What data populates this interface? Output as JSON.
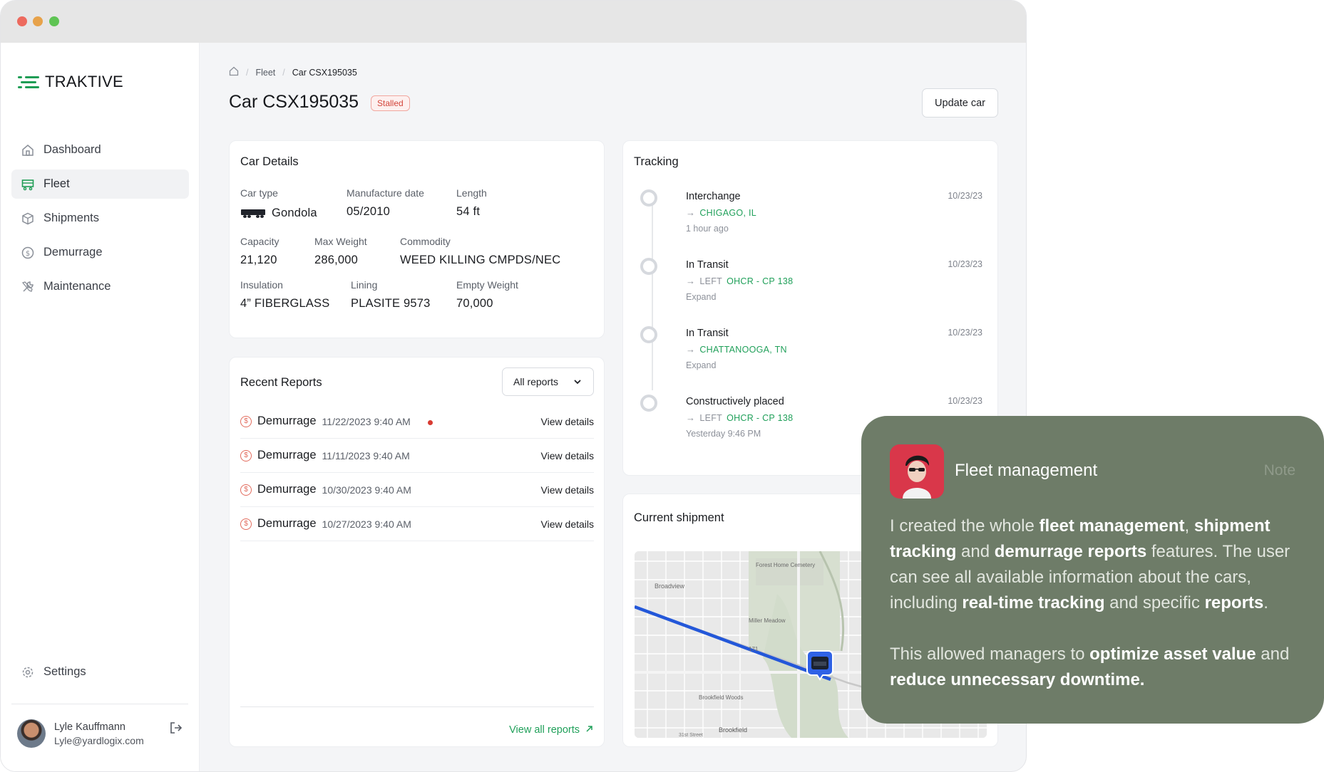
{
  "app": {
    "logo_text": "TRAKTIVE",
    "accent": "#1f9d55"
  },
  "sidebar": {
    "items": [
      {
        "label": "Dashboard",
        "icon": "home-icon",
        "active": false
      },
      {
        "label": "Fleet",
        "icon": "railcar-icon",
        "active": true
      },
      {
        "label": "Shipments",
        "icon": "box-icon",
        "active": false
      },
      {
        "label": "Demurrage",
        "icon": "dollar-circle-icon",
        "active": false
      },
      {
        "label": "Maintenance",
        "icon": "tools-icon",
        "active": false
      }
    ],
    "settings_label": "Settings",
    "user": {
      "name": "Lyle Kauffmann",
      "email": "Lyle@yardlogix.com"
    }
  },
  "breadcrumb": {
    "items": [
      "Fleet",
      "Car CSX195035"
    ]
  },
  "page": {
    "title": "Car CSX195035",
    "status_badge": "Stalled",
    "update_button": "Update car"
  },
  "car_details": {
    "title": "Car Details",
    "fields": [
      {
        "label": "Car type",
        "value": "Gondola"
      },
      {
        "label": "Manufacture date",
        "value": "05/2010"
      },
      {
        "label": "Length",
        "value": "54 ft"
      },
      {
        "label": "Capacity",
        "value": "21,120"
      },
      {
        "label": "Max Weight",
        "value": "286,000"
      },
      {
        "label": "Commodity",
        "value": "WEED KILLING CMPDS/NEC"
      },
      {
        "label": "Insulation",
        "value": "4” FIBERGLASS"
      },
      {
        "label": "Lining",
        "value": "PLASITE 9573"
      },
      {
        "label": "Empty Weight",
        "value": "70,000"
      }
    ]
  },
  "recent_reports": {
    "title": "Recent Reports",
    "filter_selected": "All reports",
    "rows": [
      {
        "type": "Demurrage",
        "datetime": "11/22/2023 9:40 AM",
        "link": "View details"
      },
      {
        "type": "Demurrage",
        "datetime": "11/11/2023 9:40 AM",
        "link": "View details"
      },
      {
        "type": "Demurrage",
        "datetime": "10/30/2023 9:40 AM",
        "link": "View details"
      },
      {
        "type": "Demurrage",
        "datetime": "10/27/2023 9:40 AM",
        "link": "View details"
      }
    ],
    "view_all": "View all reports"
  },
  "tracking": {
    "title": "Tracking",
    "events": [
      {
        "title": "Interchange",
        "prefix": "",
        "location": "CHIGAGO, IL",
        "sub": "1 hour ago",
        "date": "10/23/23"
      },
      {
        "title": "In Transit",
        "prefix": "LEFT",
        "location": "OHCR - CP 138",
        "sub": "Expand",
        "date": "10/23/23"
      },
      {
        "title": "In Transit",
        "prefix": "",
        "location": "CHATTANOOGA, TN",
        "sub": "Expand",
        "date": "10/23/23"
      },
      {
        "title": "Constructively placed",
        "prefix": "LEFT",
        "location": "OHCR - CP 138",
        "sub": "Yesterday 9:46 PM",
        "date": "10/23/23"
      }
    ]
  },
  "current_shipment": {
    "title": "Current shipment",
    "map_labels": {
      "broadview": "Broadview",
      "cemetery": "Forest Home Cemetery",
      "meadow": "Miller Meadow",
      "route": "171",
      "brookfield_woods": "Brookfield Woods",
      "brookfield": "Brookfield",
      "street": "31st Street"
    }
  },
  "note": {
    "title": "Fleet management",
    "tag": "Note",
    "p1": [
      {
        "t": "I created the whole ",
        "b": false
      },
      {
        "t": "fleet management",
        "b": true
      },
      {
        "t": ", ",
        "b": false
      },
      {
        "t": "shipment tracking",
        "b": true
      },
      {
        "t": " and ",
        "b": false
      },
      {
        "t": "demurrage reports",
        "b": true
      },
      {
        "t": " features. The user can see all available information about the cars, including ",
        "b": false
      },
      {
        "t": "real-time tracking",
        "b": true
      },
      {
        "t": " and specific ",
        "b": false
      },
      {
        "t": "reports",
        "b": true
      },
      {
        "t": ".",
        "b": false
      }
    ],
    "p2": [
      {
        "t": "This allowed managers to ",
        "b": false
      },
      {
        "t": "optimize asset value",
        "b": true
      },
      {
        "t": " and ",
        "b": false
      },
      {
        "t": "reduce unnecessary downtime.",
        "b": true
      }
    ],
    "bg": "#6e7c68"
  }
}
